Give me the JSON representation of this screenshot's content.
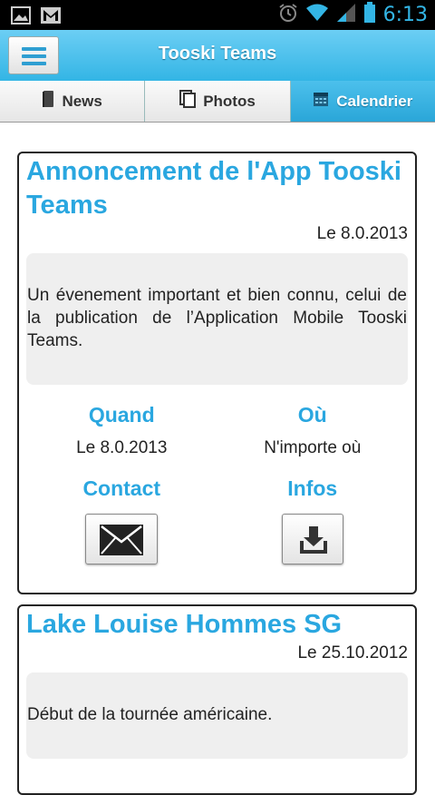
{
  "status_bar": {
    "time": "6:13",
    "left_icons": [
      "image-icon",
      "gmail-icon"
    ],
    "right_icons": [
      "alarm-icon",
      "wifi-icon",
      "signal-icon",
      "battery-icon"
    ]
  },
  "app": {
    "title": "Tooski Teams",
    "menu_icon": "hamburger-menu-icon"
  },
  "tabs": [
    {
      "label": "News",
      "icon": "book-icon",
      "active": false
    },
    {
      "label": "Photos",
      "icon": "photos-icon",
      "active": false
    },
    {
      "label": "Calendrier",
      "icon": "calendar-icon",
      "active": true
    }
  ],
  "events": [
    {
      "title": "Annoncement de l'App Tooski Teams",
      "date": "Le 8.0.2013",
      "description": "Un évenement important et bien connu, celui de la publication de l’Application Mobile Tooski Teams.",
      "when_label": "Quand",
      "when_value": "Le 8.0.2013",
      "where_label": "Où",
      "where_value": "N'importe où",
      "contact_label": "Contact",
      "contact_icon": "envelope-icon",
      "infos_label": "Infos",
      "infos_icon": "download-icon"
    },
    {
      "title": "Lake Louise Hommes SG",
      "date": "Le 25.10.2012",
      "description": "Début de la tournée américaine."
    }
  ],
  "colors": {
    "accent": "#33b5e5",
    "heading_blue": "#2aa7e0",
    "card_border": "#222222",
    "desc_bg": "#efefef"
  }
}
